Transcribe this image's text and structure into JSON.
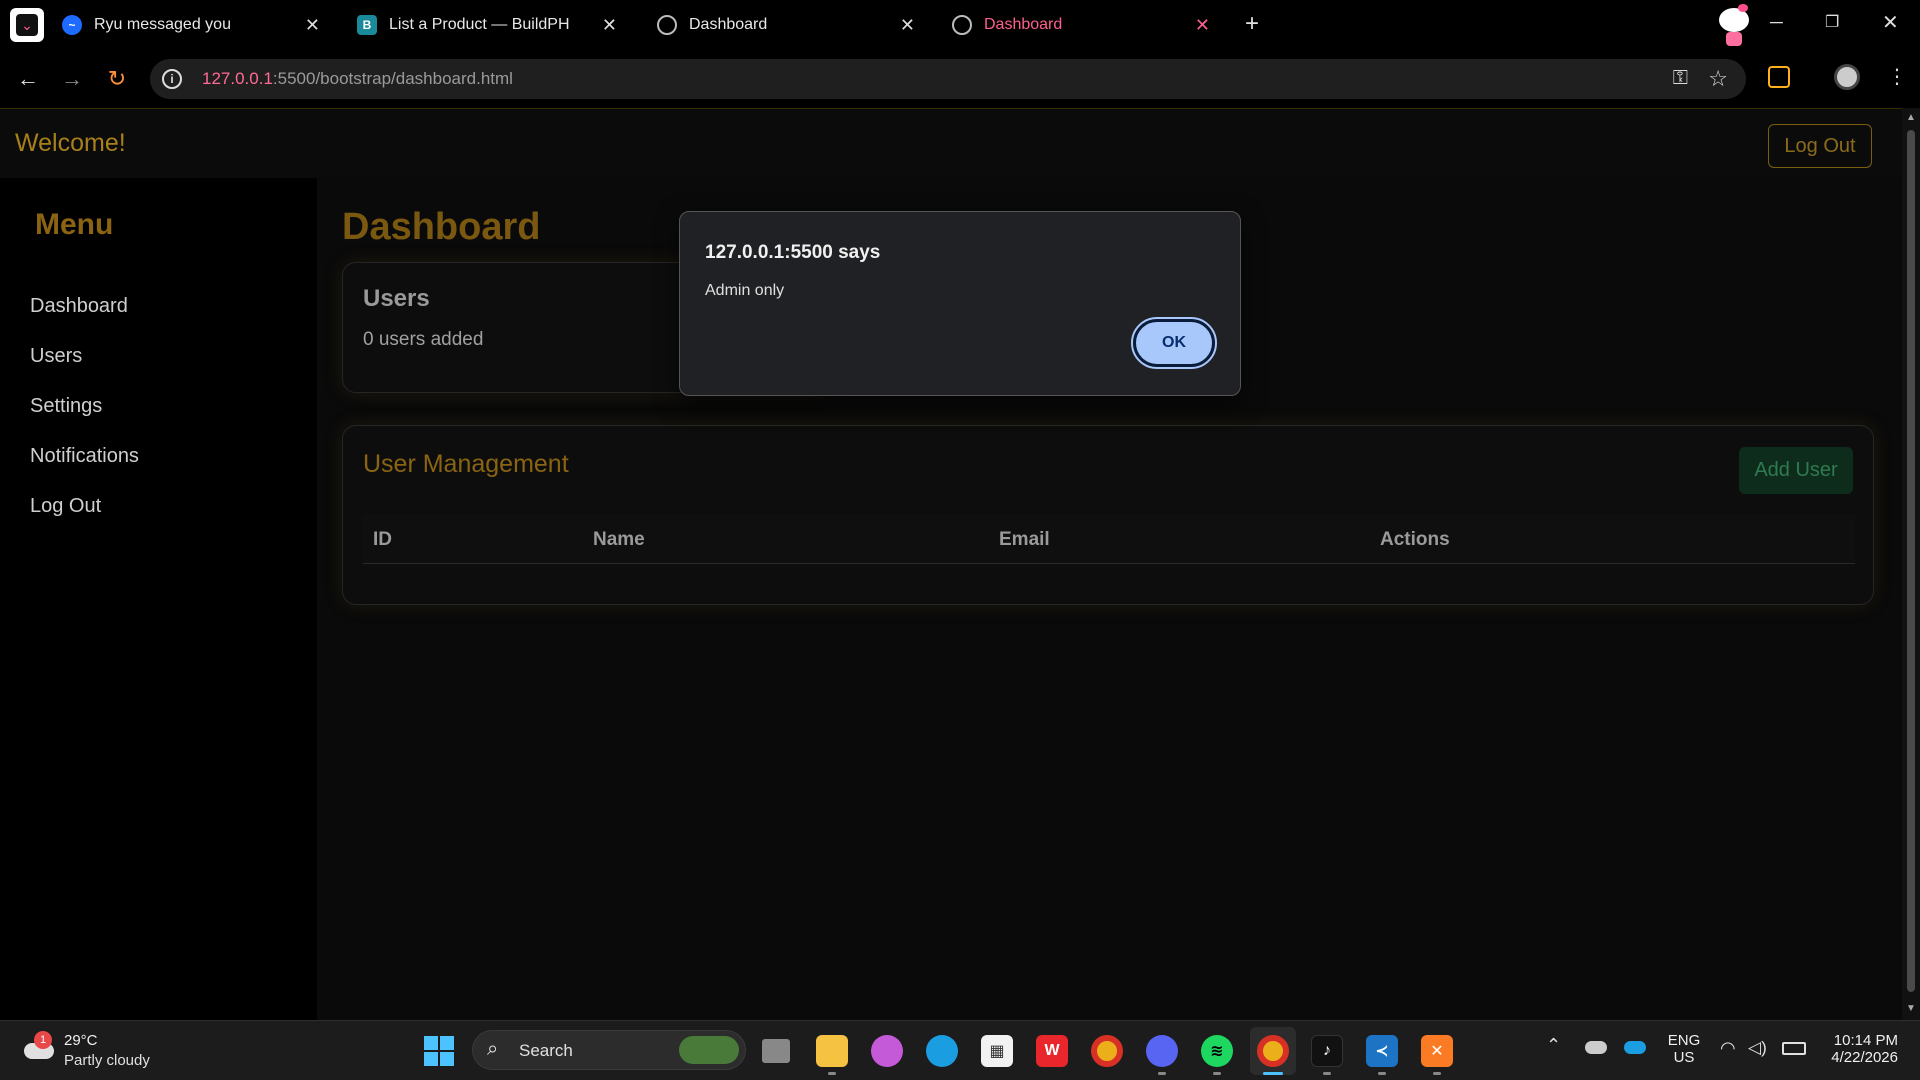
{
  "browser": {
    "tabs": [
      {
        "title": "Ryu messaged you",
        "active": false
      },
      {
        "title": "List a Product — BuildPH",
        "active": false
      },
      {
        "title": "Dashboard",
        "active": false
      },
      {
        "title": "Dashboard",
        "active": true
      }
    ],
    "url_host": "127.0.0.1",
    "url_rest": ":5500/bootstrap/dashboard.html"
  },
  "navbar": {
    "welcome": "Welcome!",
    "logout_label": "Log Out"
  },
  "sidebar": {
    "title": "Menu",
    "items": [
      {
        "label": "Dashboard"
      },
      {
        "label": "Users"
      },
      {
        "label": "Settings"
      },
      {
        "label": "Notifications"
      },
      {
        "label": "Log Out"
      }
    ]
  },
  "main": {
    "title": "Dashboard",
    "users_card": {
      "title": "Users",
      "subtitle": "0 users added"
    },
    "user_management": {
      "title": "User Management",
      "add_user_label": "Add User",
      "columns": [
        "ID",
        "Name",
        "Email",
        "Actions"
      ],
      "rows": []
    }
  },
  "alert": {
    "title": "127.0.0.1:5500 says",
    "message": "Admin only",
    "ok_label": "OK"
  },
  "taskbar": {
    "weather_temp": "29°C",
    "weather_desc": "Partly cloudy",
    "weather_badge": "1",
    "search_label": "Search",
    "lang_line1": "ENG",
    "lang_line2": "US",
    "time": "10:14 PM",
    "date": "4/22/2026"
  },
  "colors": {
    "accent_gold": "#8a6412",
    "tab_active": "#ff5f8f",
    "ok_button": "#a8c7fa",
    "add_user_bg": "#0e2c1c"
  }
}
